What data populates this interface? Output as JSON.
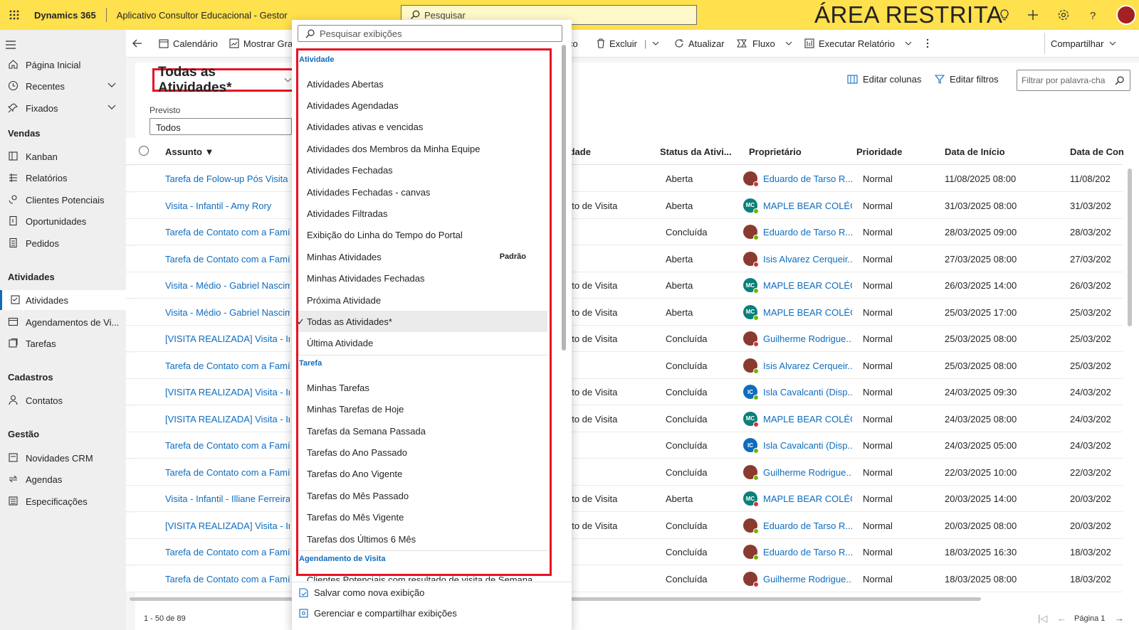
{
  "topbar": {
    "brand": "Dynamics 365",
    "app_title": "Aplicativo Consultor Educacional - Gestor",
    "search_placeholder": "Pesquisar",
    "restricted_label": "ÁREA RESTRITA"
  },
  "sidebar": {
    "top": [
      {
        "label": "Página Inicial",
        "icon": "home-icon"
      },
      {
        "label": "Recentes",
        "icon": "clock-icon"
      },
      {
        "label": "Fixados",
        "icon": "pin-icon"
      }
    ],
    "sections": [
      {
        "title": "Vendas",
        "items": [
          "Kanban",
          "Relatórios",
          "Clientes Potenciais",
          "Oportunidades",
          "Pedidos"
        ]
      },
      {
        "title": "Atividades",
        "items": [
          "Atividades",
          "Agendamentos de Vi...",
          "Tarefas"
        ]
      },
      {
        "title": "Cadastros",
        "items": [
          "Contatos"
        ]
      },
      {
        "title": "Gestão",
        "items": [
          "Novidades CRM",
          "Agendas",
          "Especificações"
        ]
      }
    ],
    "active": "Atividades"
  },
  "commandbar": {
    "items": [
      "Calendário",
      "Mostrar Gra",
      "erviço",
      "Excluir",
      "Atualizar",
      "Fluxo",
      "Executar Relatório"
    ],
    "share": "Compartilhar"
  },
  "view": {
    "title": "Todas as Atividades*",
    "filter_label": "Previsto",
    "filter_value": "Todos",
    "edit_columns": "Editar colunas",
    "edit_filters": "Editar filtros",
    "keyword_placeholder": "Filtrar por palavra-cha"
  },
  "grid": {
    "columns": [
      "Assunto",
      "idade",
      "Status da Ativi...",
      "Proprietário",
      "Prioridade",
      "Data de Início",
      "Data de Con"
    ],
    "rows": [
      {
        "subject": "Tarefa de Folow-up Pós Visita",
        "type": "",
        "status": "Aberta",
        "owner": "Eduardo de Tarso R...",
        "owner_kind": "photo",
        "priority": "Normal",
        "start": "11/08/2025 08:00",
        "end": "11/08/202"
      },
      {
        "subject": "Visita - Infantil - Amy Rory",
        "type": "nto de Visita",
        "status": "Aberta",
        "owner": "MAPLE BEAR COLÉG...",
        "owner_kind": "MC",
        "priority": "Normal",
        "start": "31/03/2025 08:00",
        "end": "31/03/202"
      },
      {
        "subject": "Tarefa de Contato com a Família",
        "type": "",
        "status": "Concluída",
        "owner": "Eduardo de Tarso R...",
        "owner_kind": "photo",
        "priority": "Normal",
        "start": "28/03/2025 09:00",
        "end": "28/03/202"
      },
      {
        "subject": "Tarefa de Contato com a Família",
        "type": "",
        "status": "Aberta",
        "owner": "Isis Alvarez Cerqueir...",
        "owner_kind": "photo",
        "priority": "Normal",
        "start": "27/03/2025 08:00",
        "end": "27/03/202"
      },
      {
        "subject": "Visita - Médio - Gabriel Nascime",
        "type": "nto de Visita",
        "status": "Aberta",
        "owner": "MAPLE BEAR COLÉG...",
        "owner_kind": "MC",
        "priority": "Normal",
        "start": "26/03/2025 14:00",
        "end": "26/03/202"
      },
      {
        "subject": "Visita - Médio - Gabriel Nascime",
        "type": "nto de Visita",
        "status": "Aberta",
        "owner": "MAPLE BEAR COLÉG...",
        "owner_kind": "MC",
        "priority": "Normal",
        "start": "25/03/2025 17:00",
        "end": "25/03/202"
      },
      {
        "subject": "[VISITA REALIZADA] Visita - Infar",
        "type": "nto de Visita",
        "status": "Concluída",
        "owner": "Guilherme Rodrigue...",
        "owner_kind": "photo",
        "priority": "Normal",
        "start": "25/03/2025 08:00",
        "end": "25/03/202"
      },
      {
        "subject": "Tarefa de Contato com a Família",
        "type": "",
        "status": "Concluída",
        "owner": "Isis Alvarez Cerqueir...",
        "owner_kind": "photo",
        "priority": "Normal",
        "start": "25/03/2025 08:00",
        "end": "25/03/202"
      },
      {
        "subject": "[VISITA REALIZADA] Visita - Infar",
        "type": "nto de Visita",
        "status": "Concluída",
        "owner": "Isla Cavalcanti (Disp...",
        "owner_kind": "IC",
        "priority": "Normal",
        "start": "24/03/2025 09:30",
        "end": "24/03/202"
      },
      {
        "subject": "[VISITA REALIZADA] Visita - Infar",
        "type": "nto de Visita",
        "status": "Concluída",
        "owner": "MAPLE BEAR COLÉG...",
        "owner_kind": "MC",
        "priority": "Normal",
        "start": "24/03/2025 08:00",
        "end": "24/03/202"
      },
      {
        "subject": "Tarefa de Contato com a Família",
        "type": "",
        "status": "Concluída",
        "owner": "Isla Cavalcanti (Disp...",
        "owner_kind": "IC",
        "priority": "Normal",
        "start": "24/03/2025 05:00",
        "end": "24/03/202"
      },
      {
        "subject": "Tarefa de Contato com a Família",
        "type": "",
        "status": "Concluída",
        "owner": "Guilherme Rodrigue...",
        "owner_kind": "photo",
        "priority": "Normal",
        "start": "22/03/2025 10:00",
        "end": "22/03/202"
      },
      {
        "subject": "Visita - Infantil - Illiane Ferreira",
        "type": "nto de Visita",
        "status": "Aberta",
        "owner": "MAPLE BEAR COLÉG...",
        "owner_kind": "MC",
        "priority": "Normal",
        "start": "20/03/2025 14:00",
        "end": "20/03/202"
      },
      {
        "subject": "[VISITA REALIZADA] Visita - Infar",
        "type": "nto de Visita",
        "status": "Concluída",
        "owner": "Eduardo de Tarso R...",
        "owner_kind": "photo",
        "priority": "Normal",
        "start": "20/03/2025 08:00",
        "end": "20/03/202"
      },
      {
        "subject": "Tarefa de Contato com a Família",
        "type": "",
        "status": "Concluída",
        "owner": "Eduardo de Tarso R...",
        "owner_kind": "photo",
        "priority": "Normal",
        "start": "18/03/2025 16:30",
        "end": "18/03/202"
      },
      {
        "subject": "Tarefa de Contato com a Família",
        "type": "",
        "status": "Concluída",
        "owner": "Guilherme Rodrigue...",
        "owner_kind": "photo",
        "priority": "Normal",
        "start": "18/03/2025 08:00",
        "end": "18/03/202"
      }
    ],
    "record_count": "1 - 50 de 89",
    "page": "Página 1"
  },
  "dropdown": {
    "search_placeholder": "Pesquisar exibições",
    "groups": [
      {
        "title": "Atividade",
        "items": [
          "Atividades Abertas",
          "Atividades Agendadas",
          "Atividades ativas e vencidas",
          "Atividades dos Membros da Minha Equipe",
          "Atividades Fechadas",
          "Atividades Fechadas - canvas",
          "Atividades Filtradas",
          "Exibição do Linha do Tempo do Portal",
          "Minhas Atividades",
          "Minhas Atividades Fechadas",
          "Próxima Atividade",
          "Todas as Atividades*",
          "Última Atividade"
        ]
      },
      {
        "title": "Tarefa",
        "items": [
          "Minhas Tarefas",
          "Minhas Tarefas de Hoje",
          "Tarefas da Semana Passada",
          "Tarefas do Ano Passado",
          "Tarefas do Ano Vigente",
          "Tarefas do Mês Passado",
          "Tarefas do Mês Vigente",
          "Tarefas dos Últimos 6 Mês"
        ]
      },
      {
        "title": "Agendamento de Visita",
        "items": []
      }
    ],
    "default_tag": "Padrão",
    "default_item": "Minhas Atividades",
    "selected_item": "Todas as Atividades*",
    "cut_item": "Clientes Potenciais com resultado de visita de Semana",
    "footer": [
      "Salvar como nova exibição",
      "Gerenciar e compartilhar exibições"
    ]
  }
}
